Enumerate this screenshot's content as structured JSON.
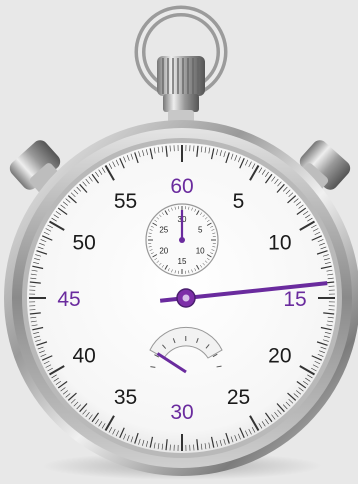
{
  "dial": {
    "outer_numerals": [
      "60",
      "5",
      "10",
      "15",
      "20",
      "25",
      "30",
      "35",
      "40",
      "45",
      "50",
      "55"
    ],
    "accent_numerals": [
      "60",
      "15",
      "30",
      "45"
    ],
    "inner_numerals": [
      "30",
      "5",
      "10",
      "15",
      "20",
      "25"
    ]
  },
  "readings": {
    "main_hand_seconds": 14,
    "sub_dial_hand_minutes": 0,
    "gauge_level": 0.15
  },
  "colors": {
    "background": "#e8e8e8",
    "accent": "#6a2b9e",
    "numeral": "#1a1a1a",
    "face": "#fdfdfd"
  },
  "icons": {
    "crown": "stopwatch-crown-icon",
    "pusher": "pusher-button-icon"
  }
}
